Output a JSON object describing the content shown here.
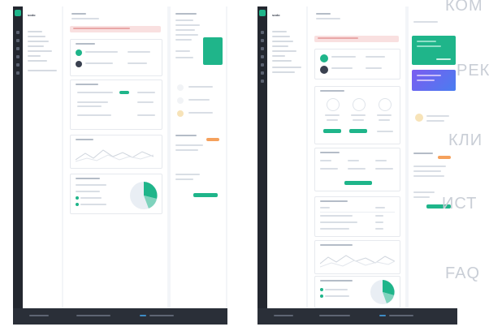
{
  "left_mock": {
    "brand": "sodo",
    "actions": {
      "primary_label": ""
    }
  },
  "right_mock": {
    "brand": "sodo"
  },
  "side_words": [
    "КОМ",
    "РЕК",
    "КЛИ",
    "ИСТ",
    "FAQ"
  ],
  "colors": {
    "accent": "#1fb58a",
    "sidebar_dark": "#23272f",
    "alert_pink": "#f9e0e0",
    "promo_purple": "#7b5cf0",
    "promo_blue": "#4a7df0",
    "badge_orange": "#f5a15c"
  }
}
